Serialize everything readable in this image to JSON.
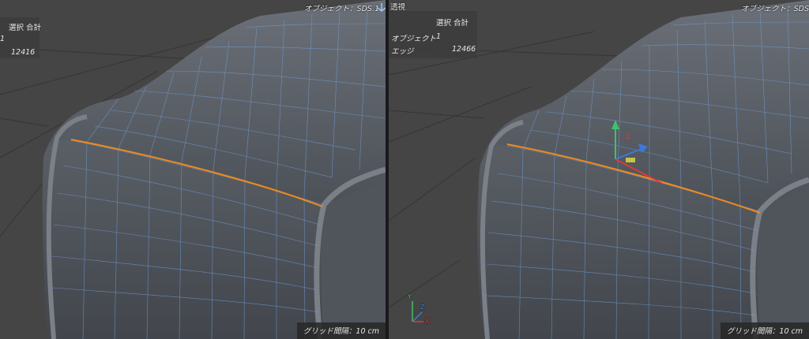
{
  "left_viewport": {
    "object_label": "オブジェクト：SDS.1",
    "stats_header": "選択 合計",
    "stats_row1_value": "1",
    "stats_row2_value": "12416",
    "grid_spacing": "グリッド間隔：10 cm"
  },
  "right_viewport": {
    "view_name": "透視",
    "object_label": "オブジェクト：SDS",
    "stats_header": "選択 合計",
    "stats_row1_label": "オブジェクト",
    "stats_row1_value": "1",
    "stats_row2_label": "エッジ",
    "stats_row2_value": "12466",
    "grid_spacing": "グリッド間隔：10 cm"
  },
  "axis_labels": {
    "y": "Y",
    "z": "Z",
    "x": "X"
  },
  "colors": {
    "selected_edge": "#f08a1c",
    "wireframe": "#6f9fd8",
    "axis_x": "#e03a3a",
    "axis_y": "#3cc46a",
    "axis_z": "#3a7ae0"
  }
}
